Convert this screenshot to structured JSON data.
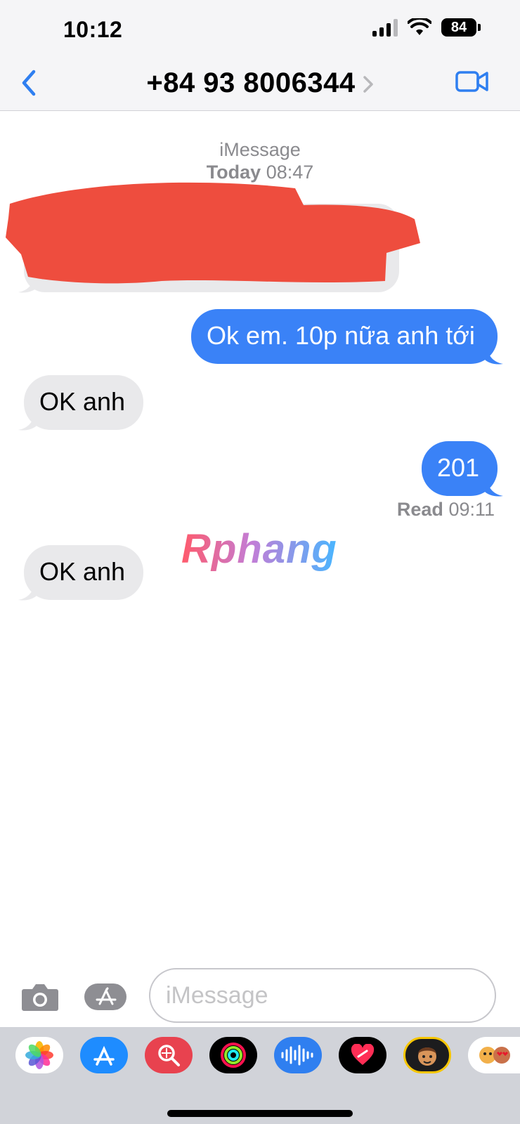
{
  "status_bar": {
    "time": "10:12",
    "battery": "84"
  },
  "nav": {
    "contact": "+84 93 8006344"
  },
  "conversation": {
    "service": "iMessage",
    "date_label": "Today",
    "date_time": "08:47",
    "messages": [
      {
        "direction": "in",
        "text": "",
        "redacted": true
      },
      {
        "direction": "out",
        "text": "Ok em. 10p nữa anh tới"
      },
      {
        "direction": "in",
        "text": "OK anh"
      },
      {
        "direction": "out",
        "text": "201"
      },
      {
        "direction": "in",
        "text": "OK anh"
      }
    ],
    "read_label": "Read",
    "read_time": "09:11"
  },
  "watermark": "Rphang",
  "input": {
    "placeholder": "iMessage"
  },
  "colors": {
    "outgoing_bubble": "#3a82f7",
    "incoming_bubble": "#e9e9eb",
    "accent": "#2f7ff0",
    "redaction": "#ee4d3e"
  },
  "app_drawer": [
    {
      "icon": "photos-icon"
    },
    {
      "icon": "app-store-icon"
    },
    {
      "icon": "image-search-icon"
    },
    {
      "icon": "activity-icon"
    },
    {
      "icon": "audio-message-icon"
    },
    {
      "icon": "digital-touch-icon"
    },
    {
      "icon": "memoji-icon"
    },
    {
      "icon": "memoji-stickers-icon"
    }
  ]
}
